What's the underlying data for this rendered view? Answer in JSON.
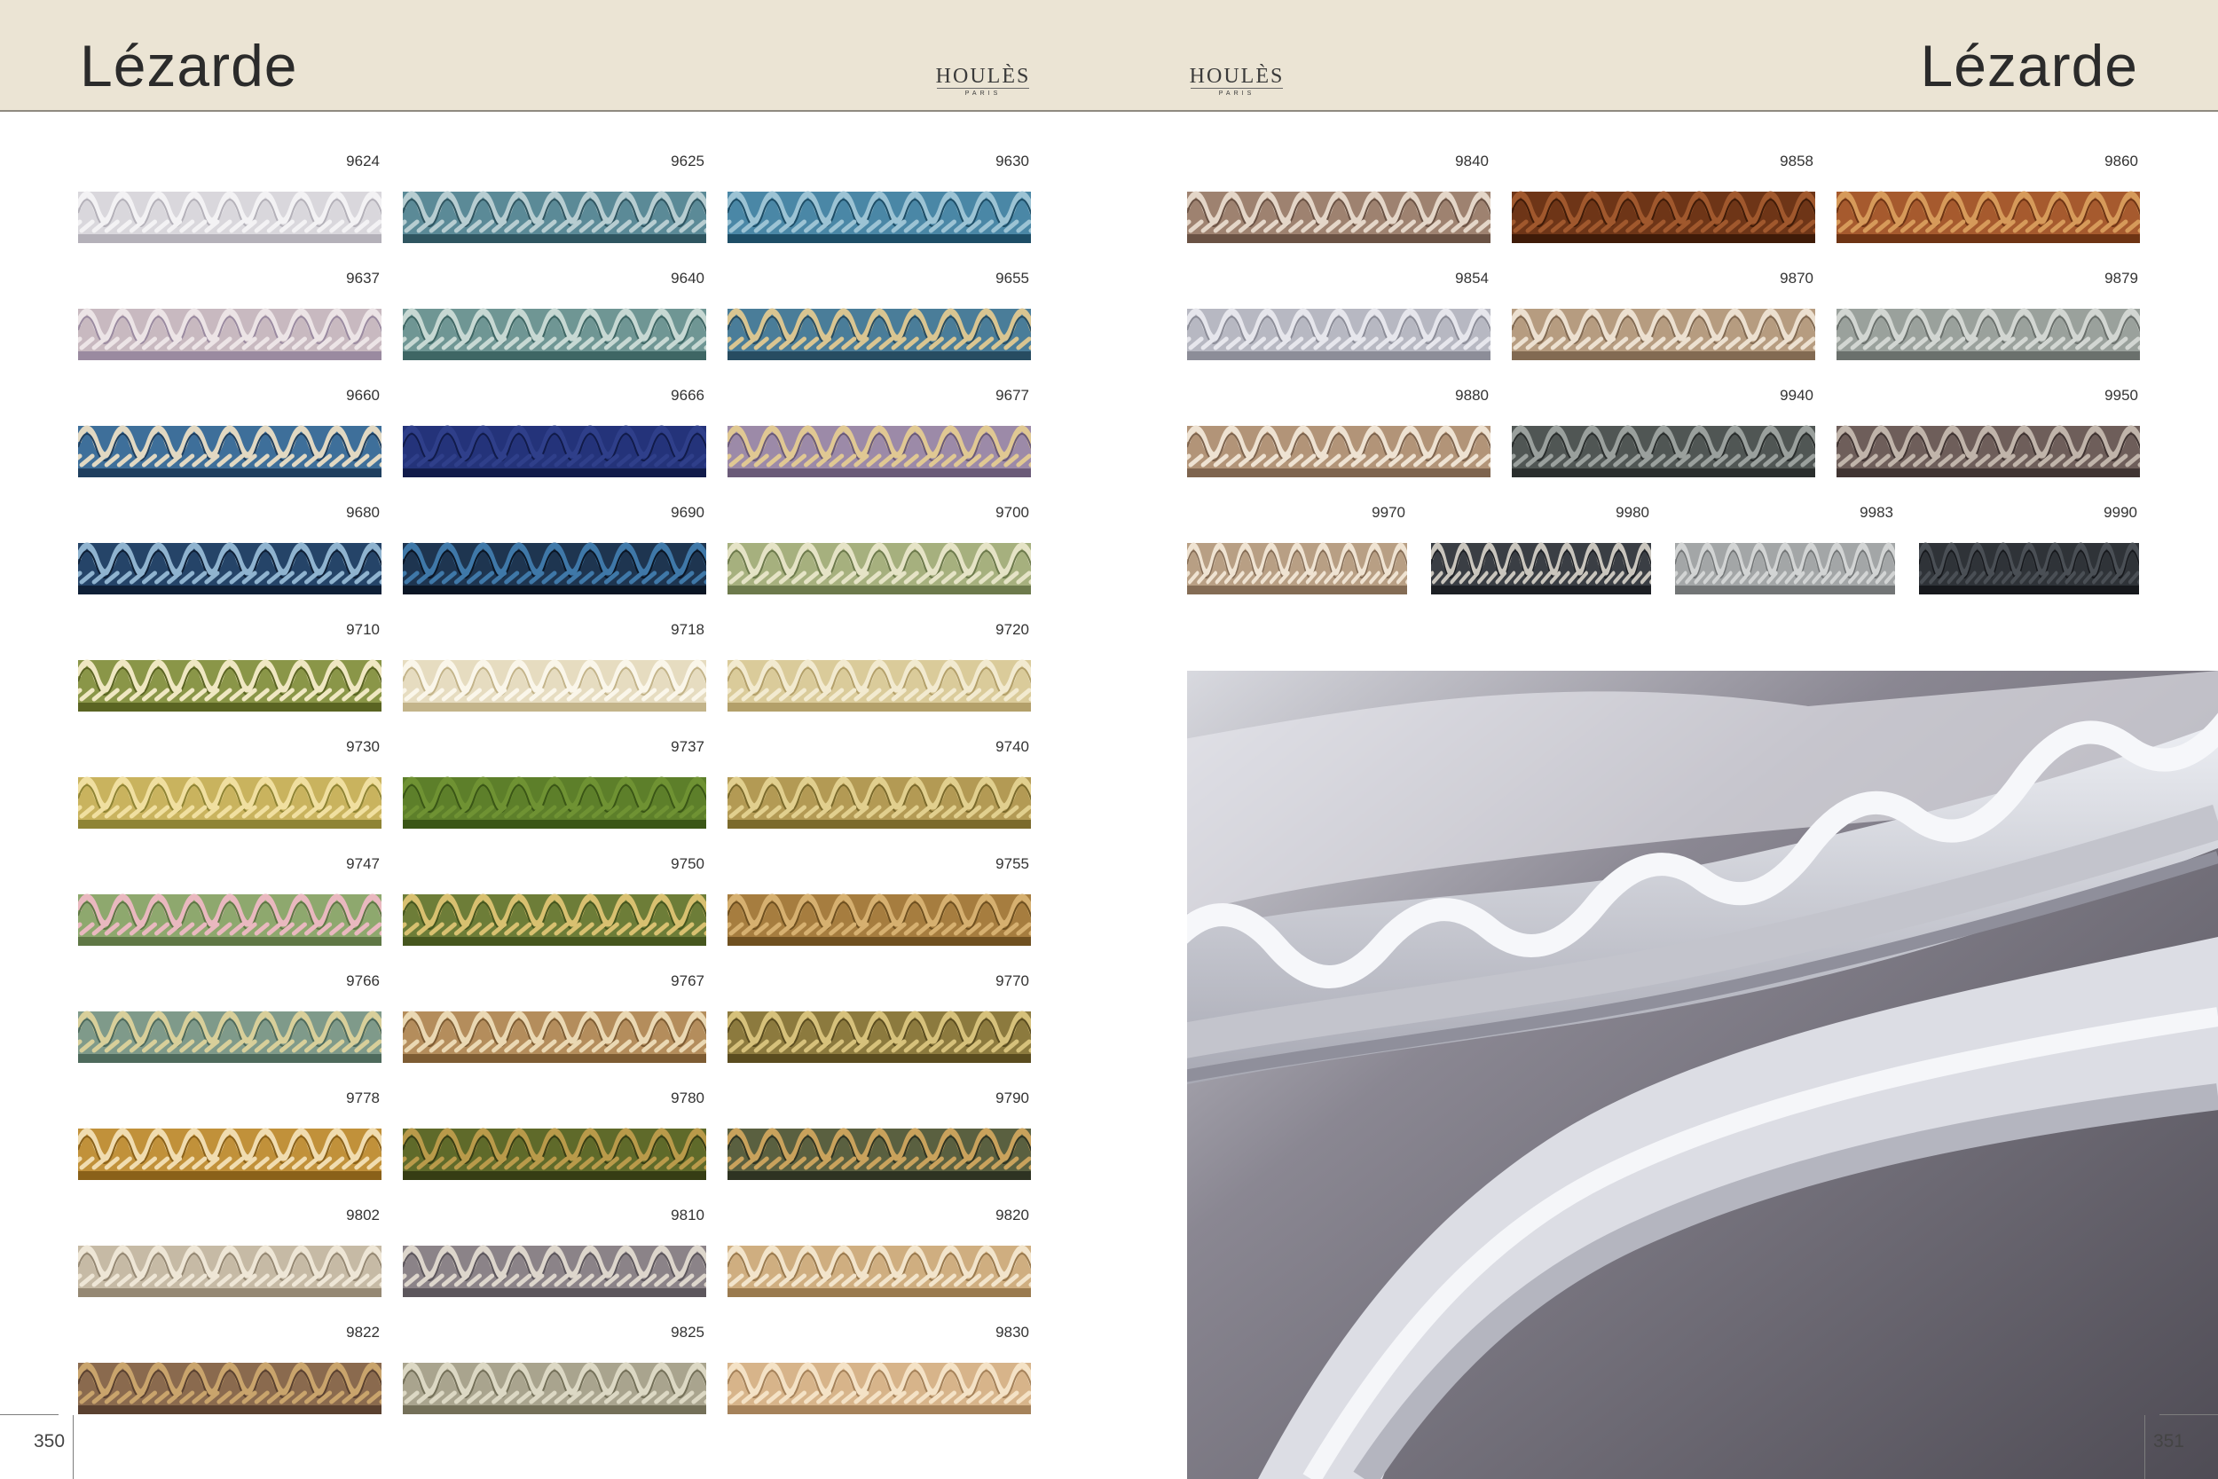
{
  "left_page": {
    "title": "Lézarde",
    "brand": {
      "name": "HOULÈS",
      "sub": "PARIS"
    },
    "page_number": "350",
    "swatches": [
      {
        "code": "9624",
        "colors": [
          "#d9d7dc",
          "#b4b1b9",
          "#f3f2f4"
        ]
      },
      {
        "code": "9625",
        "colors": [
          "#5b8a97",
          "#2f5560",
          "#b7cdd1"
        ]
      },
      {
        "code": "9630",
        "colors": [
          "#4a87a6",
          "#1d4d66",
          "#9cc3d4"
        ]
      },
      {
        "code": "9637",
        "colors": [
          "#c8b9c0",
          "#9a8aa0",
          "#ece4e6"
        ]
      },
      {
        "code": "9640",
        "colors": [
          "#6f9694",
          "#3e6664",
          "#c7d8d3"
        ]
      },
      {
        "code": "9655",
        "colors": [
          "#4a7d99",
          "#274c61",
          "#d9c591"
        ]
      },
      {
        "code": "9660",
        "colors": [
          "#3e6f9a",
          "#1f3f5f",
          "#e1d8c2"
        ]
      },
      {
        "code": "9666",
        "colors": [
          "#24337a",
          "#111b4a",
          "#2f3f8a"
        ]
      },
      {
        "code": "9677",
        "colors": [
          "#9c8aa8",
          "#6a5a78",
          "#e0c893"
        ]
      },
      {
        "code": "9680",
        "colors": [
          "#254468",
          "#0e1f36",
          "#8fb3cf"
        ]
      },
      {
        "code": "9690",
        "colors": [
          "#1e3550",
          "#0a1524",
          "#3f78a8"
        ]
      },
      {
        "code": "9700",
        "colors": [
          "#a6b07e",
          "#6d7a4c",
          "#e5e3c6"
        ]
      },
      {
        "code": "9710",
        "colors": [
          "#8a9648",
          "#5a6422",
          "#efe7c2"
        ]
      },
      {
        "code": "9718",
        "colors": [
          "#e6dcc0",
          "#c3b48a",
          "#faf6ea"
        ]
      },
      {
        "code": "9720",
        "colors": [
          "#dacb9a",
          "#b3a06a",
          "#f2ead0"
        ]
      },
      {
        "code": "9730",
        "colors": [
          "#c9b35e",
          "#8f8434",
          "#f0dfa0"
        ]
      },
      {
        "code": "9737",
        "colors": [
          "#5d7f2a",
          "#3a5616",
          "#6f9233"
        ]
      },
      {
        "code": "9740",
        "colors": [
          "#b39a54",
          "#7b6a2c",
          "#e1cf8e"
        ]
      },
      {
        "code": "9747",
        "colors": [
          "#8ea86e",
          "#5f7745",
          "#e9b8bf"
        ]
      },
      {
        "code": "9750",
        "colors": [
          "#6d7d38",
          "#46561e",
          "#d8c070"
        ]
      },
      {
        "code": "9755",
        "colors": [
          "#a67d3f",
          "#6f5020",
          "#d6b070"
        ]
      },
      {
        "code": "9766",
        "colors": [
          "#7f9a8a",
          "#4e6a5c",
          "#d8cf9a"
        ]
      },
      {
        "code": "9767",
        "colors": [
          "#b48d5c",
          "#7d5c33",
          "#ead8b3"
        ]
      },
      {
        "code": "9770",
        "colors": [
          "#8c7a3e",
          "#5a4c1f",
          "#d6c17b"
        ]
      },
      {
        "code": "9778",
        "colors": [
          "#c1913a",
          "#8a6119",
          "#f0dcb0"
        ]
      },
      {
        "code": "9780",
        "colors": [
          "#5f6a2a",
          "#363d14",
          "#b99a4a"
        ]
      },
      {
        "code": "9790",
        "colors": [
          "#5a6040",
          "#2e3322",
          "#c9a25c"
        ]
      },
      {
        "code": "9802",
        "colors": [
          "#c6baa5",
          "#958873",
          "#eee6d6"
        ]
      },
      {
        "code": "9810",
        "colors": [
          "#8b8388",
          "#5c565c",
          "#ddd6cc"
        ]
      },
      {
        "code": "9820",
        "colors": [
          "#cfae80",
          "#9a7a4e",
          "#f2e4cb"
        ]
      },
      {
        "code": "9822",
        "colors": [
          "#8a6a4e",
          "#5a4130",
          "#c9a46c"
        ]
      },
      {
        "code": "9825",
        "colors": [
          "#a9a48e",
          "#747059",
          "#dcd8c4"
        ]
      },
      {
        "code": "9830",
        "colors": [
          "#d7b48a",
          "#a5825a",
          "#f4e2c6"
        ]
      }
    ]
  },
  "right_page": {
    "title": "Lézarde",
    "brand": {
      "name": "HOULÈS",
      "sub": "PARIS"
    },
    "page_number": "351",
    "swatches_top": [
      {
        "code": "9840",
        "colors": [
          "#9e8270",
          "#6a5244",
          "#e4d6c8"
        ]
      },
      {
        "code": "9858",
        "colors": [
          "#6e3517",
          "#3f1b08",
          "#a0582d"
        ]
      },
      {
        "code": "9860",
        "colors": [
          "#a65a2e",
          "#6e3414",
          "#d69a5a"
        ]
      },
      {
        "code": "9854",
        "colors": [
          "#b7b8c2",
          "#8c8d98",
          "#e6e6ec"
        ]
      },
      {
        "code": "9870",
        "colors": [
          "#b69c80",
          "#826a52",
          "#ece0d0"
        ]
      },
      {
        "code": "9879",
        "colors": [
          "#9aa19c",
          "#6a706c",
          "#d2d6d2"
        ]
      },
      {
        "code": "9880",
        "colors": [
          "#b29478",
          "#7e644e",
          "#eee2d2"
        ]
      },
      {
        "code": "9940",
        "colors": [
          "#505654",
          "#2a2e2d",
          "#9aa09d"
        ]
      },
      {
        "code": "9950",
        "colors": [
          "#6e5e5a",
          "#403432",
          "#c0b4aa"
        ]
      }
    ],
    "swatches_bottom": [
      {
        "code": "9970",
        "colors": [
          "#b89f84",
          "#846c55",
          "#efe3d2"
        ]
      },
      {
        "code": "9980",
        "colors": [
          "#3a3e44",
          "#1c1f24",
          "#c9c5bd"
        ]
      },
      {
        "code": "9983",
        "colors": [
          "#a3a6a7",
          "#727576",
          "#d2d4d4"
        ]
      },
      {
        "code": "9990",
        "colors": [
          "#2f3338",
          "#16181c",
          "#4a4f55"
        ]
      }
    ],
    "photo": {
      "colors": [
        "#6f6b74",
        "#c9cad3",
        "#eceef3",
        "#9c9aa6"
      ]
    }
  }
}
